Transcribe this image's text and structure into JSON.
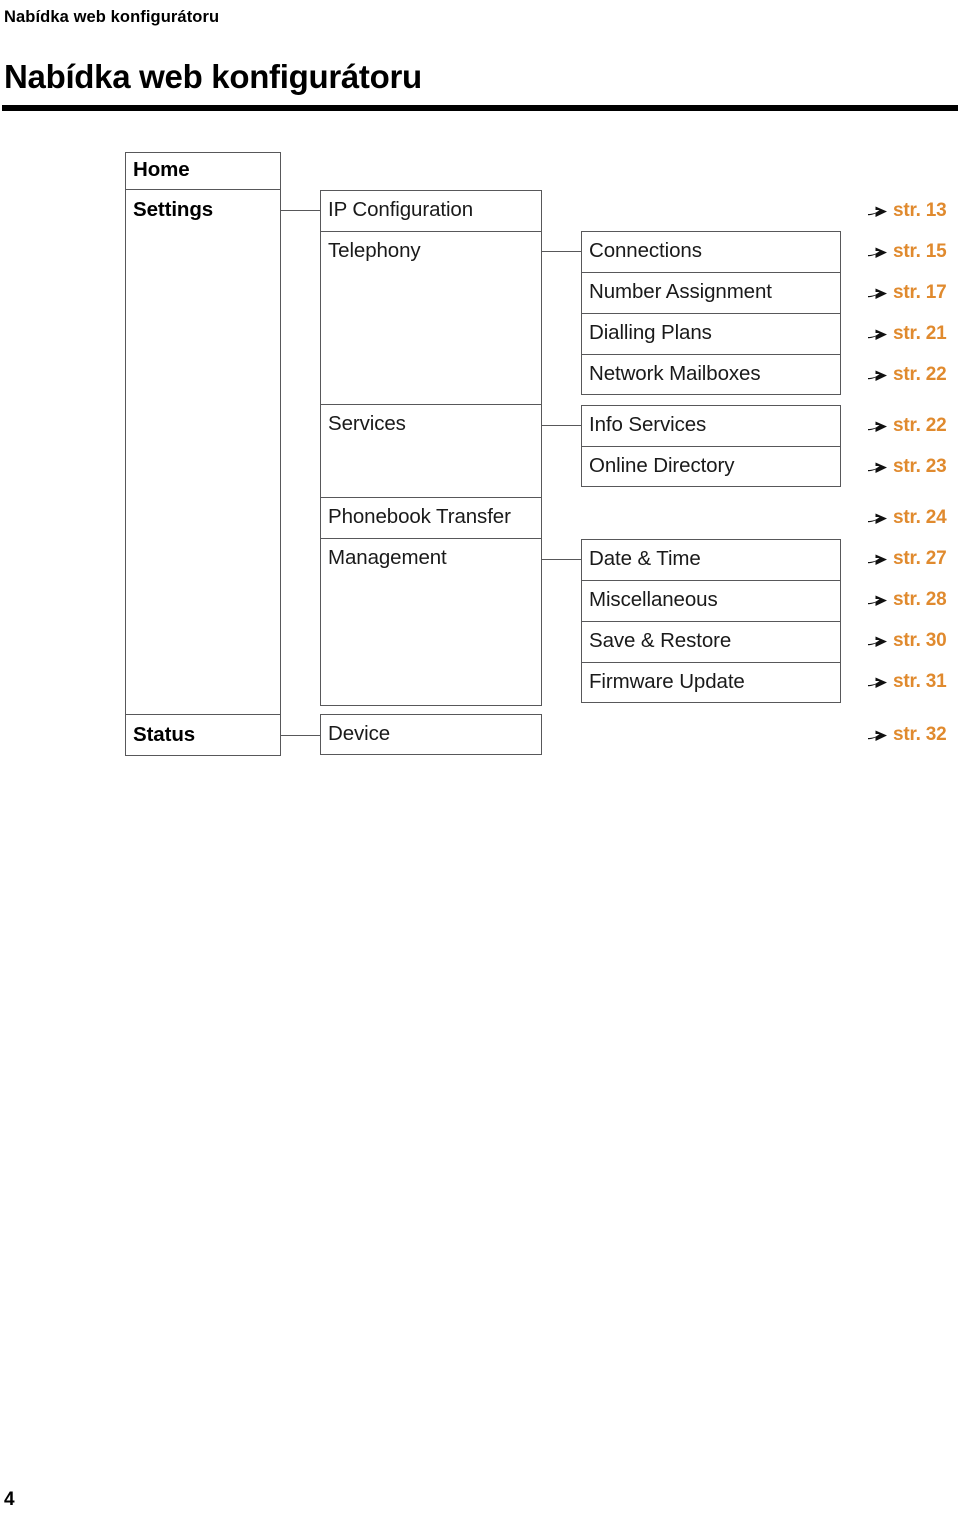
{
  "header": {
    "running_head": "Nabídka web konfigurátoru",
    "title": "Nabídka web konfigurátoru"
  },
  "colors": {
    "page_ref": "#E08A2E",
    "box_border": "#58585a",
    "rule": "#000000"
  },
  "folio": "4",
  "diagram": {
    "level1": [
      {
        "label": "Home"
      },
      {
        "label": "Settings"
      },
      {
        "label": "Status"
      }
    ],
    "level2": [
      {
        "label": "IP Configuration"
      },
      {
        "label": "Telephony"
      },
      {
        "label": "Services"
      },
      {
        "label": "Phonebook Transfer"
      },
      {
        "label": "Management"
      },
      {
        "label": "Device"
      }
    ],
    "level3": [
      {
        "label": "Connections"
      },
      {
        "label": "Number Assignment"
      },
      {
        "label": "Dialling Plans"
      },
      {
        "label": "Network Mailboxes"
      },
      {
        "label": "Info Services"
      },
      {
        "label": "Online Directory"
      },
      {
        "label": "Date & Time"
      },
      {
        "label": "Miscellaneous"
      },
      {
        "label": "Save & Restore"
      },
      {
        "label": "Firmware Update"
      }
    ],
    "page_refs": [
      {
        "label": "str. 13",
        "for": "IP Configuration"
      },
      {
        "label": "str. 15",
        "for": "Connections"
      },
      {
        "label": "str. 17",
        "for": "Number Assignment"
      },
      {
        "label": "str. 21",
        "for": "Dialling Plans"
      },
      {
        "label": "str. 22",
        "for": "Network Mailboxes"
      },
      {
        "label": "str. 22",
        "for": "Info Services"
      },
      {
        "label": "str. 23",
        "for": "Online Directory"
      },
      {
        "label": "str. 24",
        "for": "Phonebook Transfer"
      },
      {
        "label": "str. 27",
        "for": "Date & Time"
      },
      {
        "label": "str. 28",
        "for": "Miscellaneous"
      },
      {
        "label": "str. 30",
        "for": "Save & Restore"
      },
      {
        "label": "str. 31",
        "for": "Firmware Update"
      },
      {
        "label": "str. 32",
        "for": "Device"
      }
    ]
  }
}
